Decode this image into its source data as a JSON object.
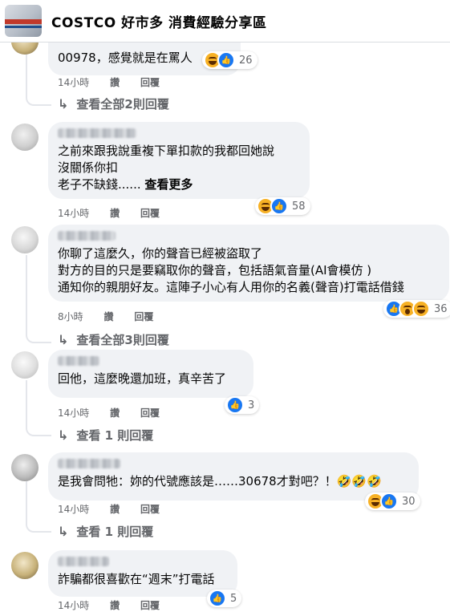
{
  "group": {
    "title": "COSTCO 好市多 消費經驗分享區",
    "thumb_icon": "group-cover-image"
  },
  "actions": {
    "like": "讚",
    "reply": "回覆"
  },
  "comments": [
    {
      "lines": [
        "00978，感覺就是在罵人"
      ],
      "reactions": [
        "haha",
        "like"
      ],
      "count": "26",
      "time": "14小時",
      "more_replies": "查看全部2則回覆"
    },
    {
      "lines": [
        "之前來跟我說重複下單扣款的我都回她說",
        "沒關係你扣",
        "老子不缺錢......"
      ],
      "see_more": "查看更多",
      "reactions": [
        "haha",
        "like"
      ],
      "count": "58",
      "time": "14小時"
    },
    {
      "lines": [
        "你聊了這麼久，你的聲音已經被盜取了",
        "對方的目的只是要竊取你的聲音，包括語氣音量(AI會模仿 )",
        "通知你的親朋好友。這陣子小心有人用你的名義(聲音)打電話借錢"
      ],
      "reactions": [
        "like",
        "wow",
        "haha"
      ],
      "count": "36",
      "time": "8小時",
      "more_replies": "查看全部3則回覆"
    },
    {
      "lines": [
        "回他，這麼晚還加班，真辛苦了"
      ],
      "reactions": [
        "like"
      ],
      "count": "3",
      "time": "14小時",
      "more_replies": "查看 1 則回覆"
    },
    {
      "lines": [
        "是我會問牠：妳的代號應該是……30678才對吧？！🤣🤣🤣"
      ],
      "reactions": [
        "haha",
        "like"
      ],
      "count": "30",
      "time": "14小時",
      "more_replies": "查看 1 則回覆"
    },
    {
      "lines": [
        "詐騙都很喜歡在“週末”打電話"
      ],
      "reactions": [
        "like"
      ],
      "count": "5",
      "time": "14小時"
    }
  ],
  "colors": {
    "bubble": "#f0f2f5",
    "meta": "#65676b",
    "like": "#1877f2",
    "haha": "#f7b125"
  }
}
